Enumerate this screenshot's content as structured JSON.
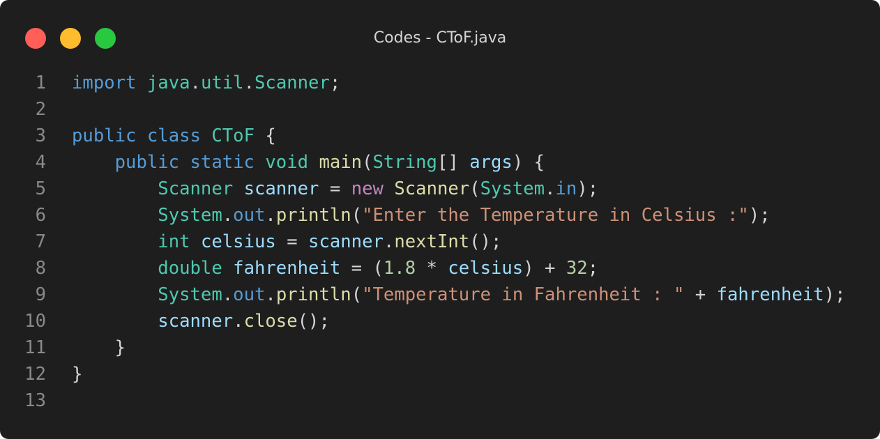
{
  "window": {
    "title": "Codes - CToF.java",
    "buttons": {
      "close_color": "#ff5f57",
      "minimize_color": "#febc2e",
      "maximize_color": "#28c840"
    }
  },
  "editor": {
    "language": "java",
    "colors": {
      "keyword": "#569cd6",
      "type": "#4ec9b0",
      "function": "#dcdcaa",
      "variable": "#9cdcfe",
      "string": "#ce9178",
      "number": "#b5cea8",
      "control": "#c586c0",
      "plain": "#d4d4d4",
      "line_number": "#8a8a8a",
      "background": "#1e1e1e"
    },
    "lines": [
      {
        "n": "1",
        "tokens": [
          {
            "t": "import",
            "c": "keyword"
          },
          {
            "t": " ",
            "c": "plain"
          },
          {
            "t": "java",
            "c": "type"
          },
          {
            "t": ".",
            "c": "plain"
          },
          {
            "t": "util",
            "c": "type"
          },
          {
            "t": ".",
            "c": "plain"
          },
          {
            "t": "Scanner",
            "c": "type"
          },
          {
            "t": ";",
            "c": "plain"
          }
        ]
      },
      {
        "n": "2",
        "tokens": []
      },
      {
        "n": "3",
        "tokens": [
          {
            "t": "public",
            "c": "keyword"
          },
          {
            "t": " ",
            "c": "plain"
          },
          {
            "t": "class",
            "c": "keyword"
          },
          {
            "t": " ",
            "c": "plain"
          },
          {
            "t": "CToF",
            "c": "type"
          },
          {
            "t": " {",
            "c": "plain"
          }
        ]
      },
      {
        "n": "4",
        "tokens": [
          {
            "t": "    ",
            "c": "plain"
          },
          {
            "t": "public",
            "c": "keyword"
          },
          {
            "t": " ",
            "c": "plain"
          },
          {
            "t": "static",
            "c": "keyword"
          },
          {
            "t": " ",
            "c": "plain"
          },
          {
            "t": "void",
            "c": "type"
          },
          {
            "t": " ",
            "c": "plain"
          },
          {
            "t": "main",
            "c": "function"
          },
          {
            "t": "(",
            "c": "plain"
          },
          {
            "t": "String",
            "c": "type"
          },
          {
            "t": "[] ",
            "c": "plain"
          },
          {
            "t": "args",
            "c": "variable"
          },
          {
            "t": ") {",
            "c": "plain"
          }
        ]
      },
      {
        "n": "5",
        "tokens": [
          {
            "t": "        ",
            "c": "plain"
          },
          {
            "t": "Scanner",
            "c": "type"
          },
          {
            "t": " ",
            "c": "plain"
          },
          {
            "t": "scanner",
            "c": "variable"
          },
          {
            "t": " = ",
            "c": "plain"
          },
          {
            "t": "new",
            "c": "control"
          },
          {
            "t": " ",
            "c": "plain"
          },
          {
            "t": "Scanner",
            "c": "function"
          },
          {
            "t": "(",
            "c": "plain"
          },
          {
            "t": "System",
            "c": "type"
          },
          {
            "t": ".",
            "c": "plain"
          },
          {
            "t": "in",
            "c": "keyword"
          },
          {
            "t": ");",
            "c": "plain"
          }
        ]
      },
      {
        "n": "6",
        "tokens": [
          {
            "t": "        ",
            "c": "plain"
          },
          {
            "t": "System",
            "c": "type"
          },
          {
            "t": ".",
            "c": "plain"
          },
          {
            "t": "out",
            "c": "keyword"
          },
          {
            "t": ".",
            "c": "plain"
          },
          {
            "t": "println",
            "c": "function"
          },
          {
            "t": "(",
            "c": "plain"
          },
          {
            "t": "\"Enter the Temperature in Celsius :\"",
            "c": "string"
          },
          {
            "t": ");",
            "c": "plain"
          }
        ]
      },
      {
        "n": "7",
        "tokens": [
          {
            "t": "        ",
            "c": "plain"
          },
          {
            "t": "int",
            "c": "type"
          },
          {
            "t": " ",
            "c": "plain"
          },
          {
            "t": "celsius",
            "c": "variable"
          },
          {
            "t": " = ",
            "c": "plain"
          },
          {
            "t": "scanner",
            "c": "variable"
          },
          {
            "t": ".",
            "c": "plain"
          },
          {
            "t": "nextInt",
            "c": "function"
          },
          {
            "t": "();",
            "c": "plain"
          }
        ]
      },
      {
        "n": "8",
        "tokens": [
          {
            "t": "        ",
            "c": "plain"
          },
          {
            "t": "double",
            "c": "type"
          },
          {
            "t": " ",
            "c": "plain"
          },
          {
            "t": "fahrenheit",
            "c": "variable"
          },
          {
            "t": " = (",
            "c": "plain"
          },
          {
            "t": "1.8",
            "c": "number"
          },
          {
            "t": " * ",
            "c": "plain"
          },
          {
            "t": "celsius",
            "c": "variable"
          },
          {
            "t": ") + ",
            "c": "plain"
          },
          {
            "t": "32",
            "c": "number"
          },
          {
            "t": ";",
            "c": "plain"
          }
        ]
      },
      {
        "n": "9",
        "tokens": [
          {
            "t": "        ",
            "c": "plain"
          },
          {
            "t": "System",
            "c": "type"
          },
          {
            "t": ".",
            "c": "plain"
          },
          {
            "t": "out",
            "c": "keyword"
          },
          {
            "t": ".",
            "c": "plain"
          },
          {
            "t": "println",
            "c": "function"
          },
          {
            "t": "(",
            "c": "plain"
          },
          {
            "t": "\"Temperature in Fahrenheit : \"",
            "c": "string"
          },
          {
            "t": " + ",
            "c": "plain"
          },
          {
            "t": "fahrenheit",
            "c": "variable"
          },
          {
            "t": ");",
            "c": "plain"
          }
        ]
      },
      {
        "n": "10",
        "tokens": [
          {
            "t": "        ",
            "c": "plain"
          },
          {
            "t": "scanner",
            "c": "variable"
          },
          {
            "t": ".",
            "c": "plain"
          },
          {
            "t": "close",
            "c": "function"
          },
          {
            "t": "();",
            "c": "plain"
          }
        ]
      },
      {
        "n": "11",
        "tokens": [
          {
            "t": "    }",
            "c": "plain"
          }
        ]
      },
      {
        "n": "12",
        "tokens": [
          {
            "t": "}",
            "c": "plain"
          }
        ]
      },
      {
        "n": "13",
        "tokens": []
      }
    ]
  }
}
